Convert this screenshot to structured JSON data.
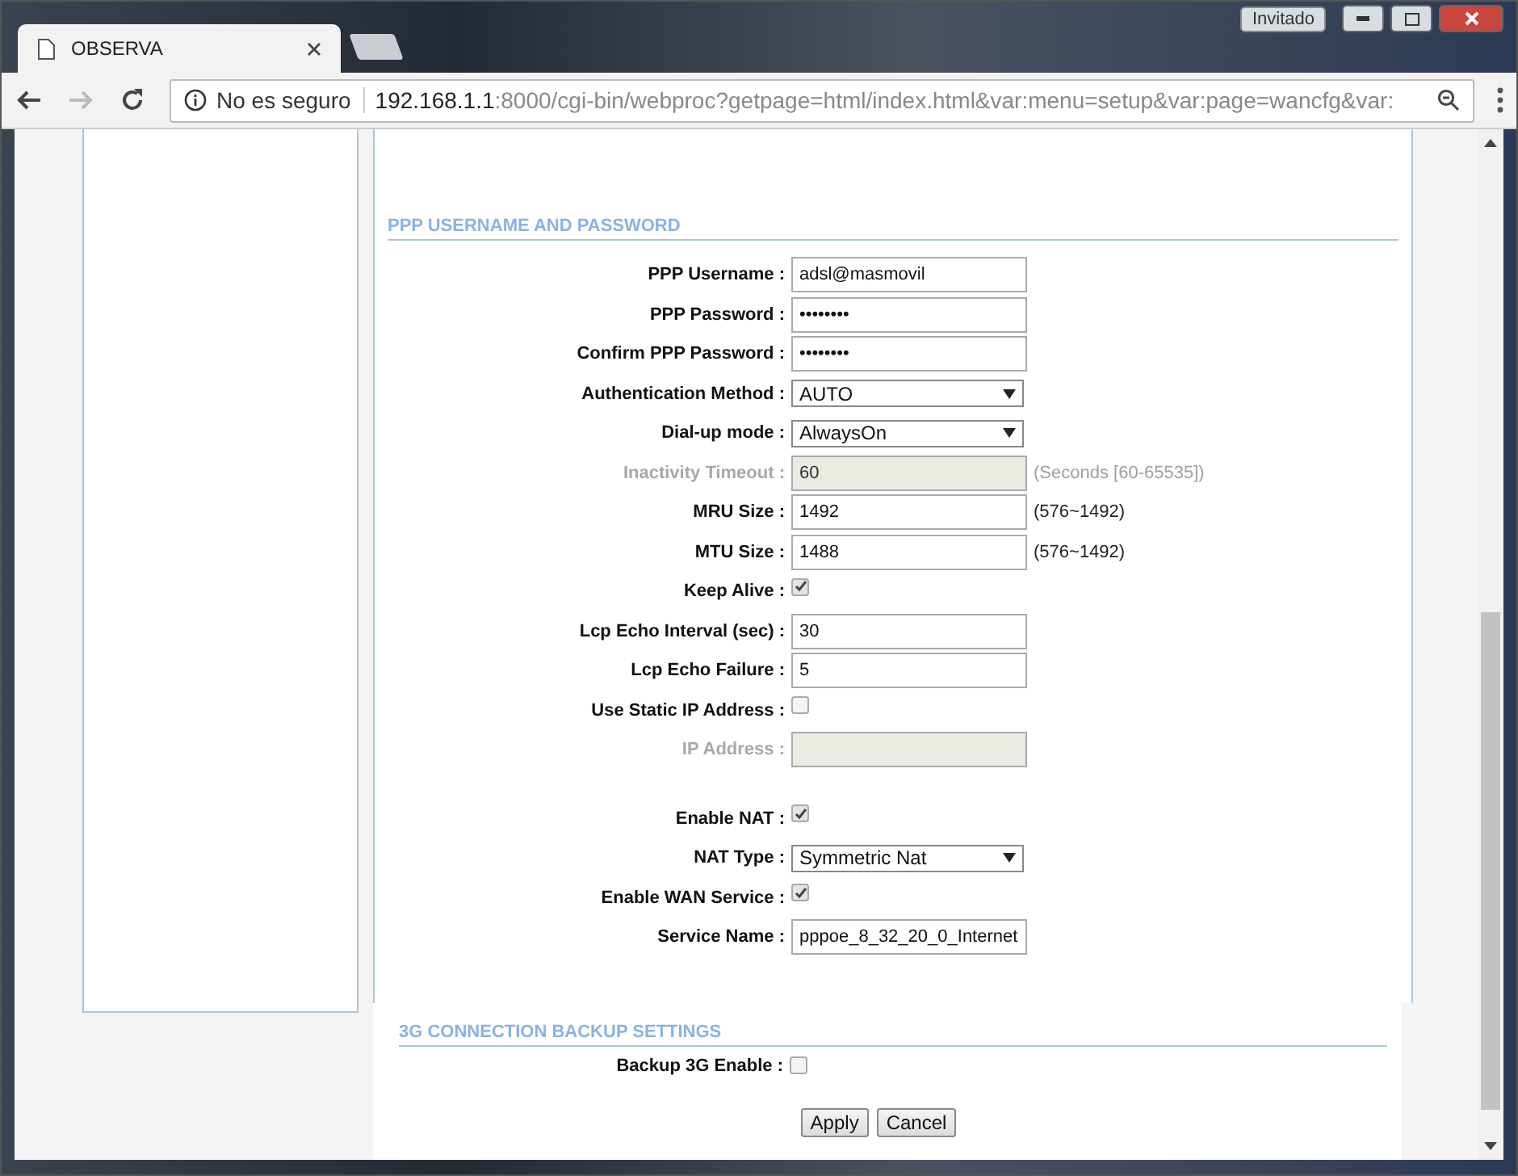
{
  "browser": {
    "tab_title": "OBSERVA",
    "profile": "Invitado",
    "security": "No es seguro",
    "url_host": "192.168.1.1",
    "url_rest": ":8000/cgi-bin/webproc?getpage=html/index.html&var:menu=setup&var:page=wancfg&var:"
  },
  "ppp_section": {
    "title": "PPP USERNAME AND PASSWORD",
    "rows": [
      {
        "kind": "text",
        "label": "PPP Username :",
        "value": "adsl@masmovil",
        "disabled": false
      },
      {
        "kind": "text",
        "label": "PPP Password :",
        "value": "••••••••",
        "disabled": false
      },
      {
        "kind": "text",
        "label": "Confirm PPP Password :",
        "value": "••••••••",
        "disabled": false
      },
      {
        "kind": "select",
        "label": "Authentication Method :",
        "value": "AUTO",
        "disabled": false
      },
      {
        "kind": "select",
        "label": "Dial-up mode :",
        "value": "AlwaysOn",
        "disabled": false
      },
      {
        "kind": "text",
        "label": "Inactivity Timeout :",
        "value": "60",
        "note": "(Seconds [60-65535])",
        "disabled": true
      },
      {
        "kind": "text",
        "label": "MRU Size :",
        "value": "1492",
        "note": "(576~1492)",
        "disabled": false
      },
      {
        "kind": "text",
        "label": "MTU Size :",
        "value": "1488",
        "note": "(576~1492)",
        "disabled": false
      },
      {
        "kind": "checkbox",
        "label": "Keep Alive :",
        "checked": true
      },
      {
        "kind": "text",
        "label": "Lcp Echo Interval (sec) :",
        "value": "30",
        "disabled": false
      },
      {
        "kind": "text",
        "label": "Lcp Echo Failure :",
        "value": "5",
        "disabled": false
      },
      {
        "kind": "checkbox",
        "label": "Use Static IP Address :",
        "checked": false
      },
      {
        "kind": "text",
        "label": "IP Address :",
        "disabled": true
      },
      {
        "kind": "spacer"
      },
      {
        "kind": "checkbox",
        "label": "Enable NAT :",
        "checked": true
      },
      {
        "kind": "select",
        "label": "NAT Type :",
        "value": "Symmetric Nat",
        "disabled": false
      },
      {
        "kind": "checkbox",
        "label": "Enable WAN Service :",
        "checked": true
      },
      {
        "kind": "text",
        "label": "Service Name :",
        "value": "pppoe_8_32_20_0_Internet",
        "disabled": false
      }
    ]
  },
  "backup_section": {
    "title": "3G CONNECTION BACKUP SETTINGS",
    "rows": [
      {
        "kind": "checkbox",
        "label": "Backup 3G Enable :",
        "checked": false
      }
    ]
  },
  "buttons": [
    "Apply",
    "Cancel"
  ]
}
